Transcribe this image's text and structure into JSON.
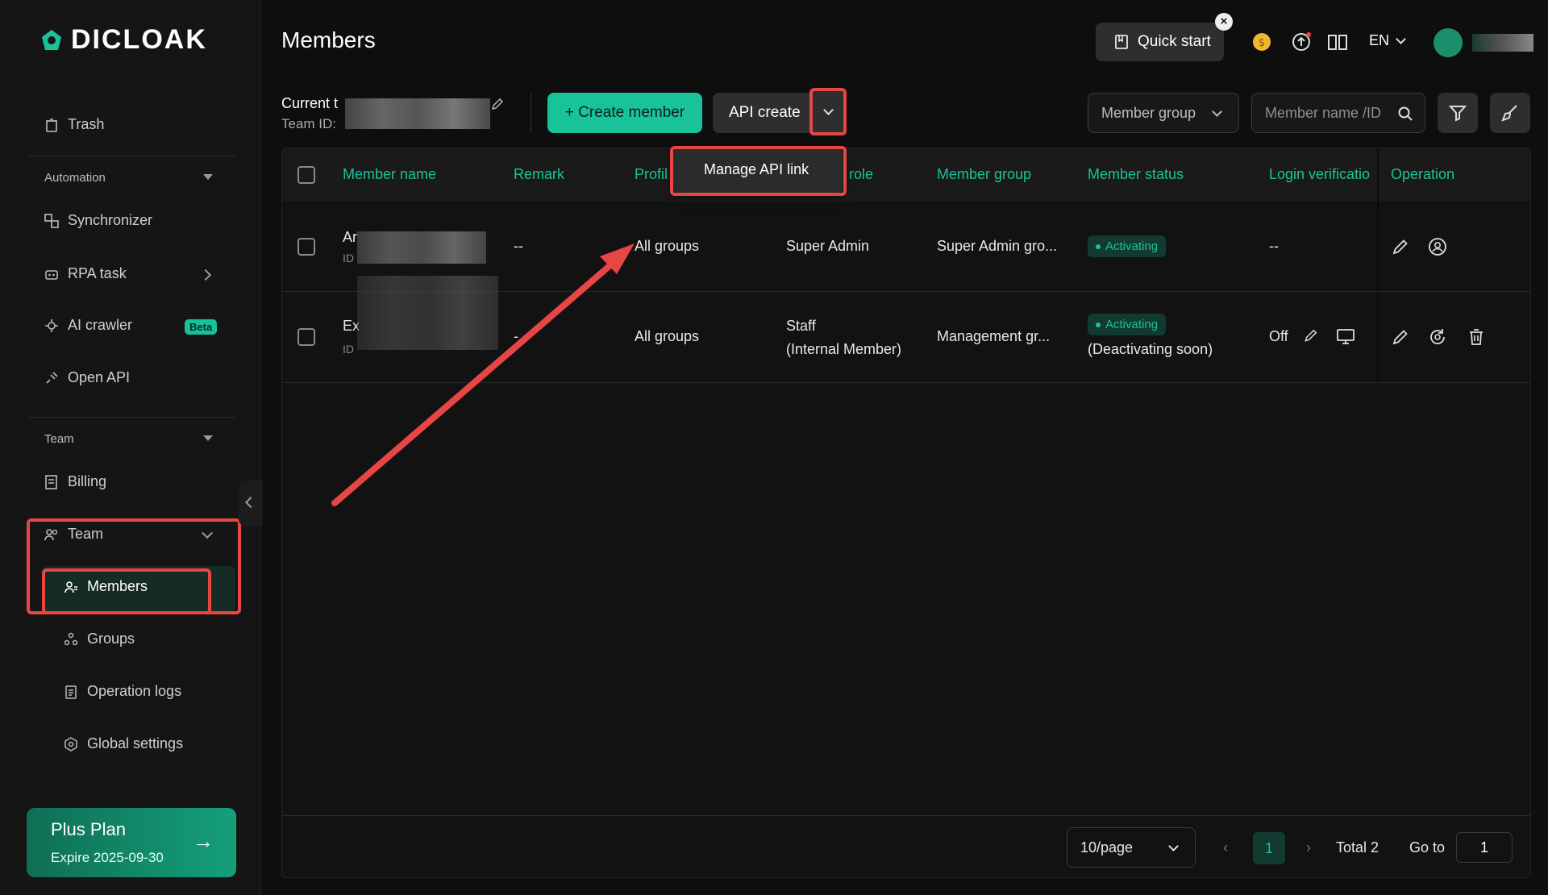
{
  "app": {
    "logo_text": "DICLOAK"
  },
  "sidebar": {
    "trash": "Trash",
    "automation_header": "Automation",
    "synchronizer": "Synchronizer",
    "rpa_task": "RPA task",
    "ai_crawler": "AI crawler",
    "beta_badge": "Beta",
    "open_api": "Open API",
    "team_header": "Team",
    "billing": "Billing",
    "team": "Team",
    "members": "Members",
    "groups": "Groups",
    "operation_logs": "Operation logs",
    "global_settings": "Global settings",
    "plan": {
      "name": "Plus Plan",
      "expire": "Expire 2025-09-30"
    }
  },
  "header": {
    "title": "Members",
    "quick_start": "Quick start",
    "language": "EN"
  },
  "toolbar": {
    "current_team_label": "Current t",
    "team_id_label": "Team ID:",
    "create_member": "+ Create member",
    "api_create": "API create",
    "member_group_placeholder": "Member group",
    "search_placeholder": "Member name /ID"
  },
  "dropdown": {
    "manage_api_link": "Manage API link"
  },
  "table": {
    "columns": [
      "Member name",
      "Remark",
      "Profil",
      "role",
      "Member group",
      "Member status",
      "Login verificatio",
      "Operation"
    ],
    "rows": [
      {
        "name_prefix": "Ar",
        "id_prefix": "ID",
        "remark": "--",
        "profile": "All groups",
        "role": "Super Admin",
        "role2": "",
        "group": "Super Admin gro...",
        "status": "Activating",
        "status_note": "",
        "login": "--"
      },
      {
        "name_prefix": "Ex",
        "id_prefix": "ID",
        "remark": "-",
        "profile": "All groups",
        "role": "Staff",
        "role2": "(Internal Member)",
        "group": "Management gr...",
        "status": "Activating",
        "status_note": "(Deactivating soon)",
        "login": "Off"
      }
    ]
  },
  "pagination": {
    "page_size": "10/page",
    "current": "1",
    "total": "Total 2",
    "goto_label": "Go to",
    "goto_value": "1"
  },
  "colors": {
    "accent": "#19c39a",
    "highlight": "#e84545"
  }
}
